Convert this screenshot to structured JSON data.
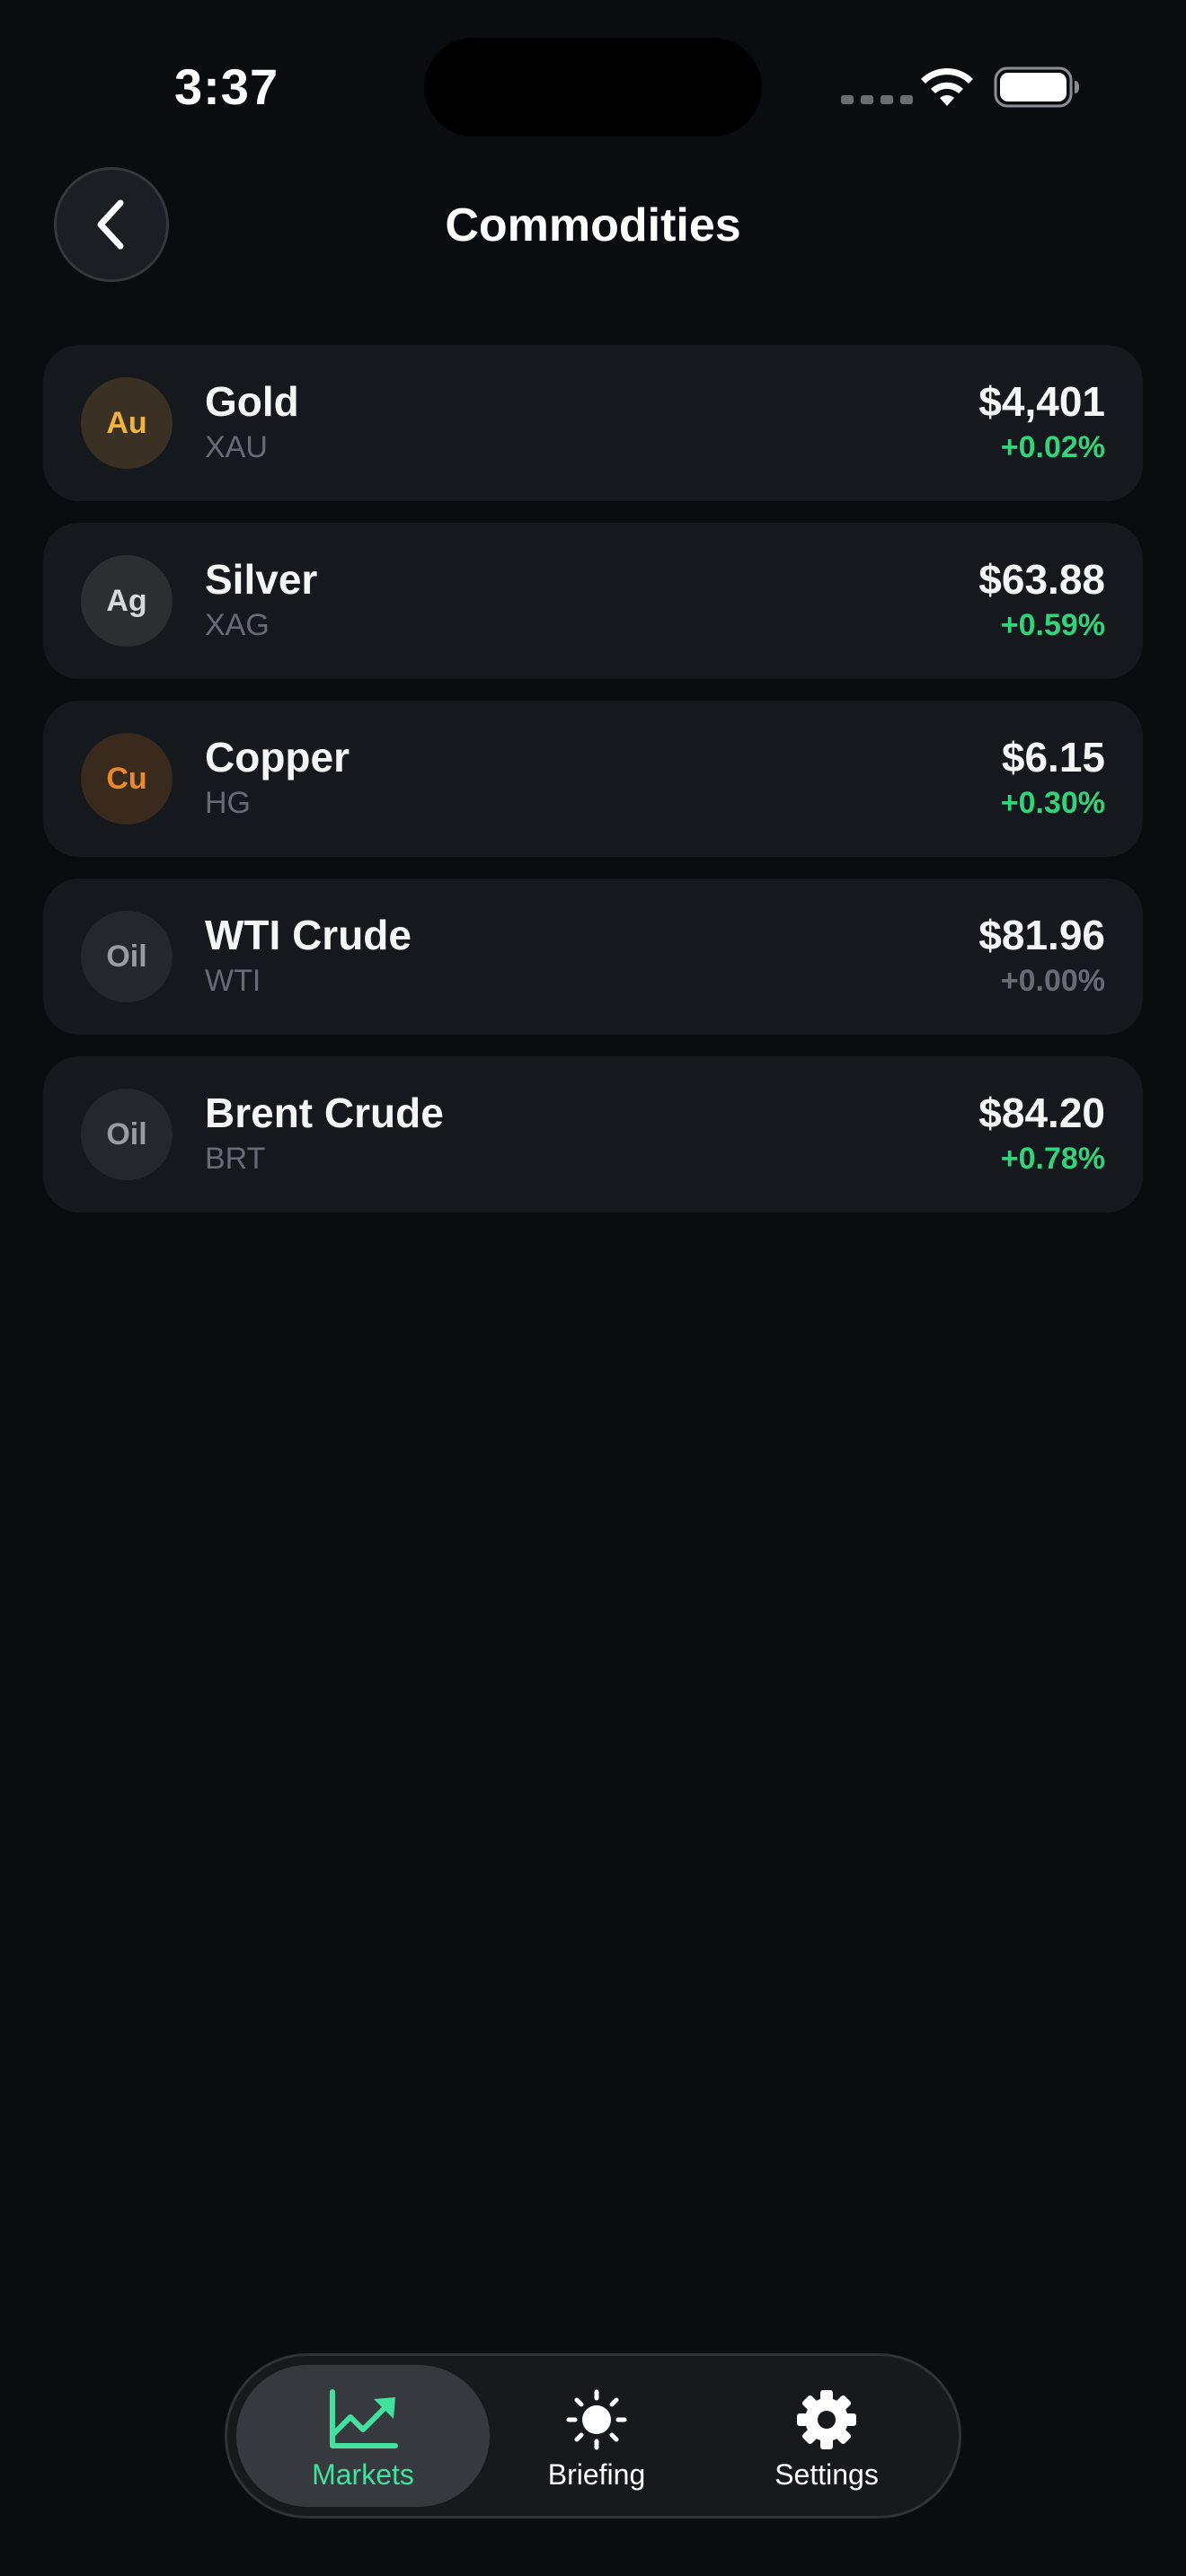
{
  "status_bar": {
    "time": "3:37",
    "icons": [
      "cellular-signal-icon",
      "wifi-icon",
      "battery-icon"
    ]
  },
  "header": {
    "title": "Commodities",
    "back_icon": "chevron-left-icon"
  },
  "colors": {
    "background": "#0a0d10",
    "card": "#15181c",
    "positive": "#34d27b",
    "neutral": "#676c74",
    "accent": "#43e0a0"
  },
  "commodities": [
    {
      "badge": "Au",
      "name": "Gold",
      "symbol": "XAU",
      "price": "$4,401",
      "change": "+0.02%",
      "change_color": "#34d27b",
      "badge_color": "#f2b33d",
      "badge_bg": "#3a3023"
    },
    {
      "badge": "Ag",
      "name": "Silver",
      "symbol": "XAG",
      "price": "$63.88",
      "change": "+0.59%",
      "change_color": "#34d27b",
      "badge_color": "#d8d9dc",
      "badge_bg": "#2c2e32"
    },
    {
      "badge": "Cu",
      "name": "Copper",
      "symbol": "HG",
      "price": "$6.15",
      "change": "+0.30%",
      "change_color": "#34d27b",
      "badge_color": "#e8892e",
      "badge_bg": "#3a2a1d"
    },
    {
      "badge": "Oil",
      "name": "WTI Crude",
      "symbol": "WTI",
      "price": "$81.96",
      "change": "+0.00%",
      "change_color": "#676c74",
      "badge_color": "#9a9ca2",
      "badge_bg": "#25272c"
    },
    {
      "badge": "Oil",
      "name": "Brent Crude",
      "symbol": "BRT",
      "price": "$84.20",
      "change": "+0.78%",
      "change_color": "#34d27b",
      "badge_color": "#9a9ca2",
      "badge_bg": "#25272c"
    }
  ],
  "tab_bar": {
    "tabs": [
      {
        "label": "Markets",
        "icon": "chart-trending-up-icon",
        "active": true
      },
      {
        "label": "Briefing",
        "icon": "sun-icon",
        "active": false
      },
      {
        "label": "Settings",
        "icon": "gear-icon",
        "active": false
      }
    ]
  }
}
